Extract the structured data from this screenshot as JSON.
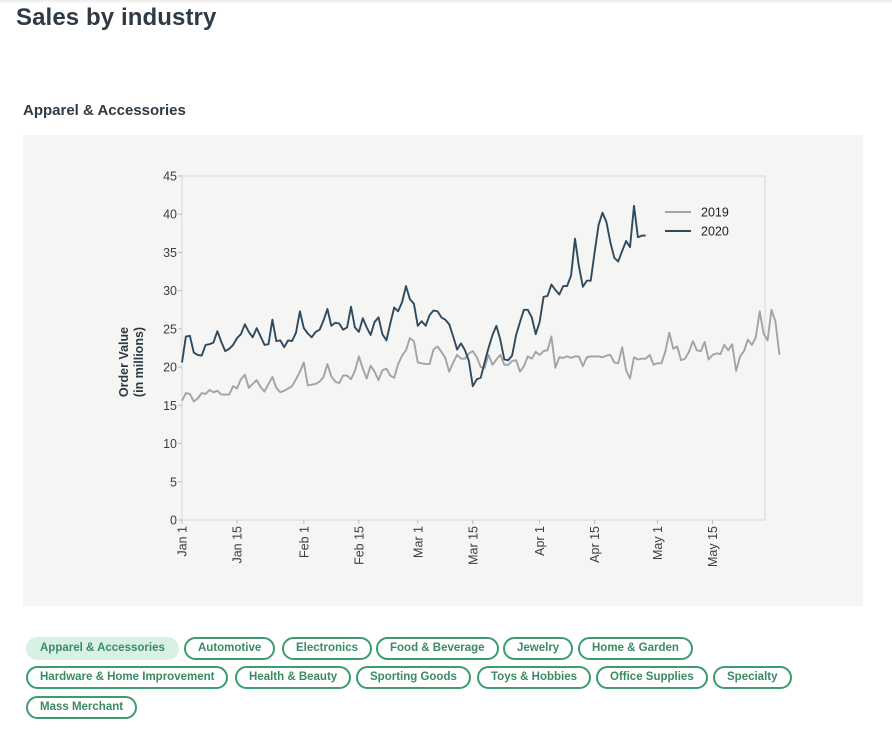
{
  "page": {
    "title": "Sales by industry",
    "section_title": "Apparel & Accessories"
  },
  "filters": {
    "active": "Apparel & Accessories",
    "items": [
      "Apparel & Accessories",
      "Automotive",
      "Electronics",
      "Food & Beverage",
      "Jewelry",
      "Home & Garden",
      "Hardware & Home Improvement",
      "Health & Beauty",
      "Sporting Goods",
      "Toys & Hobbies",
      "Office Supplies",
      "Specialty",
      "Mass Merchant"
    ]
  },
  "colors": {
    "series_2019": "#a3a3a3",
    "series_2020": "#2f4a5f",
    "pill_border": "#3b9d6e",
    "pill_active_bg": "#d9f1e5"
  },
  "chart_data": {
    "type": "line",
    "title": "Apparel & Accessories",
    "xlabel": "",
    "ylabel": "Order Value (in millions)",
    "ylabel_lines": [
      "Order Value",
      "(in millions)"
    ],
    "ylim": [
      0,
      45
    ],
    "yticks": [
      0,
      5,
      10,
      15,
      20,
      25,
      30,
      35,
      40,
      45
    ],
    "x_unit": "day of year (0 = Jan 1)",
    "xlim": [
      0,
      148
    ],
    "xticks": [
      {
        "day": 0,
        "label": "Jan 1"
      },
      {
        "day": 14,
        "label": "Jan 15"
      },
      {
        "day": 31,
        "label": "Feb 1"
      },
      {
        "day": 45,
        "label": "Feb 15"
      },
      {
        "day": 60,
        "label": "Mar 1"
      },
      {
        "day": 74,
        "label": "Mar 15"
      },
      {
        "day": 91,
        "label": "Apr 1"
      },
      {
        "day": 105,
        "label": "Apr 15"
      },
      {
        "day": 121,
        "label": "May 1"
      },
      {
        "day": 135,
        "label": "May 15"
      }
    ],
    "grid": false,
    "legend": {
      "position": "top-right",
      "entries": [
        "2019",
        "2020"
      ]
    },
    "series": [
      {
        "name": "2019",
        "start_day": 0,
        "values": [
          15.6,
          16.6,
          16.5,
          15.5,
          15.9,
          16.6,
          16.5,
          17.0,
          16.7,
          16.9,
          16.4,
          16.4,
          16.4,
          17.5,
          17.2,
          18.4,
          19.0,
          17.3,
          17.8,
          18.3,
          17.4,
          16.8,
          17.8,
          18.7,
          17.3,
          16.7,
          16.9,
          17.2,
          17.5,
          18.4,
          19.4,
          20.6,
          17.6,
          17.7,
          17.8,
          18.1,
          18.7,
          20.4,
          18.8,
          18.1,
          17.9,
          18.9,
          18.9,
          18.4,
          19.5,
          21.4,
          19.8,
          18.5,
          20.2,
          19.4,
          18.3,
          19.6,
          19.8,
          18.9,
          18.6,
          20.4,
          21.5,
          22.2,
          23.8,
          23.4,
          20.6,
          20.5,
          20.4,
          20.4,
          22.3,
          22.7,
          22.0,
          21.2,
          19.4,
          20.6,
          21.6,
          21.1,
          21.1,
          21.8,
          22.1,
          21.3,
          20.0,
          19.9,
          21.6,
          20.3,
          21.0,
          21.6,
          20.3,
          20.3,
          20.8,
          20.9,
          19.4,
          20.1,
          21.4,
          21.1,
          22.0,
          21.6,
          22.1,
          22.2,
          24.0,
          19.9,
          21.3,
          21.2,
          21.4,
          21.2,
          21.4,
          21.4,
          20.1,
          21.3,
          21.4,
          21.4,
          21.4,
          21.3,
          21.5,
          21.6,
          20.6,
          20.5,
          22.6,
          19.6,
          18.5,
          21.3,
          21.0,
          21.1,
          21.1,
          21.6,
          20.3,
          20.5,
          20.5,
          22.1,
          24.5,
          22.4,
          22.7,
          20.9,
          21.1,
          22.0,
          23.4,
          22.2,
          22.1,
          23.3,
          21.0,
          21.6,
          21.8,
          21.7,
          22.9,
          22.2,
          23.0,
          19.5,
          21.4,
          22.1,
          23.6,
          22.9,
          23.9,
          27.3,
          24.4,
          23.5,
          27.5,
          26.0,
          21.6
        ]
      },
      {
        "name": "2020",
        "start_day": 0,
        "values": [
          20.6,
          24.0,
          24.1,
          21.9,
          21.6,
          21.5,
          22.9,
          23.0,
          23.2,
          24.7,
          23.3,
          22.1,
          22.4,
          22.9,
          23.8,
          24.3,
          25.6,
          24.6,
          23.9,
          25.1,
          24.0,
          22.9,
          23.0,
          26.2,
          23.4,
          23.5,
          22.6,
          23.5,
          23.4,
          24.5,
          27.3,
          25.1,
          24.4,
          23.9,
          24.6,
          24.9,
          26.1,
          27.6,
          25.4,
          25.8,
          25.7,
          24.9,
          25.2,
          27.9,
          25.2,
          24.6,
          26.4,
          25.2,
          24.2,
          25.9,
          26.5,
          24.3,
          23.5,
          25.7,
          27.8,
          27.3,
          28.5,
          30.6,
          28.9,
          28.3,
          25.4,
          26.0,
          25.4,
          26.8,
          27.4,
          27.3,
          26.5,
          26.2,
          25.6,
          24.0,
          22.3,
          23.1,
          22.2,
          20.8,
          17.5,
          18.4,
          18.6,
          20.6,
          22.5,
          24.2,
          25.4,
          23.6,
          21.0,
          20.9,
          21.5,
          24.2,
          25.9,
          27.5,
          27.5,
          26.5,
          24.3,
          25.9,
          29.2,
          29.3,
          30.8,
          30.1,
          29.5,
          30.6,
          30.6,
          32.0,
          36.8,
          33.2,
          30.5,
          31.3,
          31.3,
          35.1,
          38.6,
          40.2,
          39.0,
          36.3,
          34.3,
          33.8,
          35.2,
          36.5,
          35.7,
          41.1,
          37.0,
          37.2,
          37.2
        ]
      }
    ]
  }
}
